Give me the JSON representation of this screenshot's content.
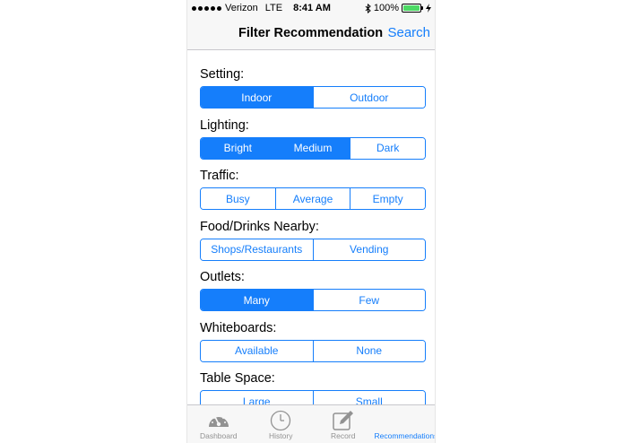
{
  "status_bar": {
    "carrier": "Verizon",
    "network": "LTE",
    "time": "8:41 AM",
    "battery": "100%",
    "battery_level": 1.0
  },
  "nav": {
    "title": "Filter Recommendation",
    "action": "Search"
  },
  "filters": [
    {
      "label": "Setting:",
      "options": [
        "Indoor",
        "Outdoor"
      ],
      "selected": [
        0
      ]
    },
    {
      "label": "Lighting:",
      "options": [
        "Bright",
        "Medium",
        "Dark"
      ],
      "selected": [
        0,
        1
      ]
    },
    {
      "label": "Traffic:",
      "options": [
        "Busy",
        "Average",
        "Empty"
      ],
      "selected": []
    },
    {
      "label": "Food/Drinks Nearby:",
      "options": [
        "Shops/Restaurants",
        "Vending"
      ],
      "selected": []
    },
    {
      "label": "Outlets:",
      "options": [
        "Many",
        "Few"
      ],
      "selected": [
        0
      ]
    },
    {
      "label": "Whiteboards:",
      "options": [
        "Available",
        "None"
      ],
      "selected": []
    },
    {
      "label": "Table Space:",
      "options": [
        "Large",
        "Small"
      ],
      "selected": []
    }
  ],
  "tabs": [
    {
      "label": "Dashboard",
      "icon": "dashboard-gauge-icon",
      "active": false
    },
    {
      "label": "History",
      "icon": "clock-icon",
      "active": false
    },
    {
      "label": "Record",
      "icon": "edit-pencil-icon",
      "active": false
    },
    {
      "label": "Recommendations",
      "icon": "recommendations-icon",
      "active": true
    }
  ],
  "colors": {
    "accent": "#157efb",
    "inactive_tab": "#929292",
    "battery": "#4cd964"
  }
}
